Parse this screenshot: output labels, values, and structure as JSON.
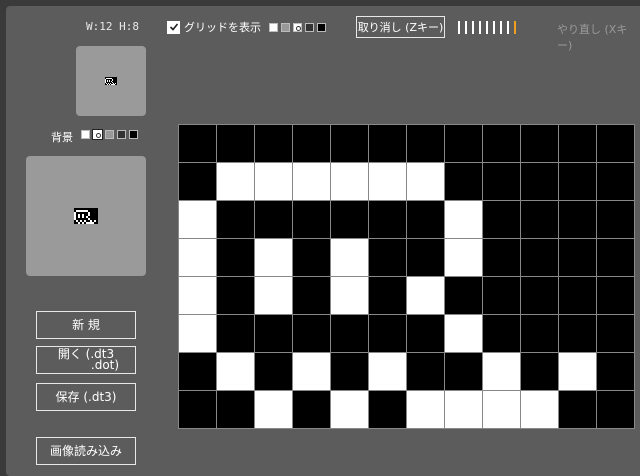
{
  "toolbar": {
    "size_label": "W:12 H:8",
    "grid_toggle_label": "グリッドを表示",
    "grid_checked": true,
    "undo_label": "取り消し (Zキー)",
    "redo_label": "やり直し (Xキー)",
    "history_count": 9,
    "history_current_index": 8,
    "history_current_color": "#f0a020"
  },
  "grid_colors": {
    "swatches": [
      "#ffffff",
      "#999999",
      "transparent",
      "#333333",
      "#000000"
    ]
  },
  "background": {
    "label": "背景",
    "swatches": [
      "#ffffff",
      "transparent",
      "#999999",
      "#333333",
      "#000000"
    ],
    "selected_index": 1
  },
  "buttons": {
    "new_label": "新 規",
    "open_label_1": "開く (.dt3",
    "open_label_2": ".dot)",
    "save_label": "保存 (.dt3)",
    "import_image_label": "画像読み込み"
  },
  "canvas": {
    "width": 12,
    "height": 8,
    "rows": [
      "bbbbbbbbbbbb",
      "bwwwwwwbbbbb",
      "wbbbbbbwbbbb",
      "wbwbwbbwbbbb",
      "wbwbwbwbbbbb",
      "wbbbbbbwbbbb",
      "bwbwbwbbwbwb",
      "bbwbwbwwwwbb"
    ]
  }
}
